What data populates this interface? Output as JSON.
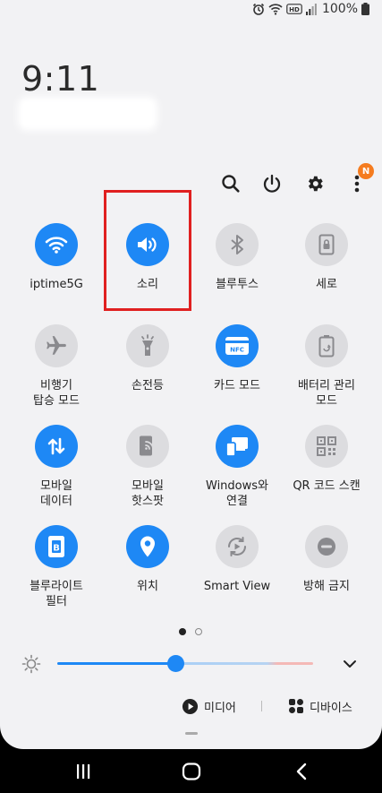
{
  "status_bar": {
    "battery_text": "100%",
    "icons": [
      "alarm-icon",
      "wifi-icon",
      "hd-icon",
      "signal-icon",
      "battery-icon"
    ]
  },
  "clock": {
    "time": "9:11"
  },
  "top_actions": {
    "icons": [
      "search-icon",
      "power-icon",
      "settings-icon",
      "more-icon"
    ],
    "notification_badge": "N"
  },
  "tiles": [
    {
      "label": "iptime5G",
      "icon": "wifi-icon",
      "state": "on"
    },
    {
      "label": "소리",
      "icon": "sound-icon",
      "state": "on"
    },
    {
      "label": "블루투스",
      "icon": "bluetooth-icon",
      "state": "off"
    },
    {
      "label": "세로",
      "icon": "portrait-lock-icon",
      "state": "off"
    },
    {
      "label": "비행기\n탑승 모드",
      "icon": "airplane-icon",
      "state": "off"
    },
    {
      "label": "손전등",
      "icon": "flashlight-icon",
      "state": "off"
    },
    {
      "label": "카드 모드",
      "icon": "nfc-icon",
      "state": "on"
    },
    {
      "label": "배터리 관리\n모드",
      "icon": "battery-saver-icon",
      "state": "off"
    },
    {
      "label": "모바일\n데이터",
      "icon": "mobile-data-icon",
      "state": "on"
    },
    {
      "label": "모바일\n핫스팟",
      "icon": "hotspot-icon",
      "state": "off"
    },
    {
      "label": "Windows와\n연결",
      "icon": "link-to-windows-icon",
      "state": "on"
    },
    {
      "label": "QR 코드 스캔",
      "icon": "qr-code-icon",
      "state": "off"
    },
    {
      "label": "블루라이트\n필터",
      "icon": "blue-light-filter-icon",
      "state": "on"
    },
    {
      "label": "위치",
      "icon": "location-icon",
      "state": "on"
    },
    {
      "label": "Smart View",
      "icon": "smart-view-icon",
      "state": "off"
    },
    {
      "label": "방해 금지",
      "icon": "do-not-disturb-icon",
      "state": "off"
    }
  ],
  "pager": {
    "pages": 2,
    "active": 1
  },
  "brightness": {
    "value": 0.46,
    "icon": "brightness-icon"
  },
  "output": {
    "media_label": "미디어",
    "devices_label": "디바이스"
  },
  "colors": {
    "accent": "#1e88f5",
    "tile_off": "#dcdcdf",
    "panel_bg": "#f2f2f4",
    "highlight": "#e02020",
    "badge": "#f57c1f"
  }
}
